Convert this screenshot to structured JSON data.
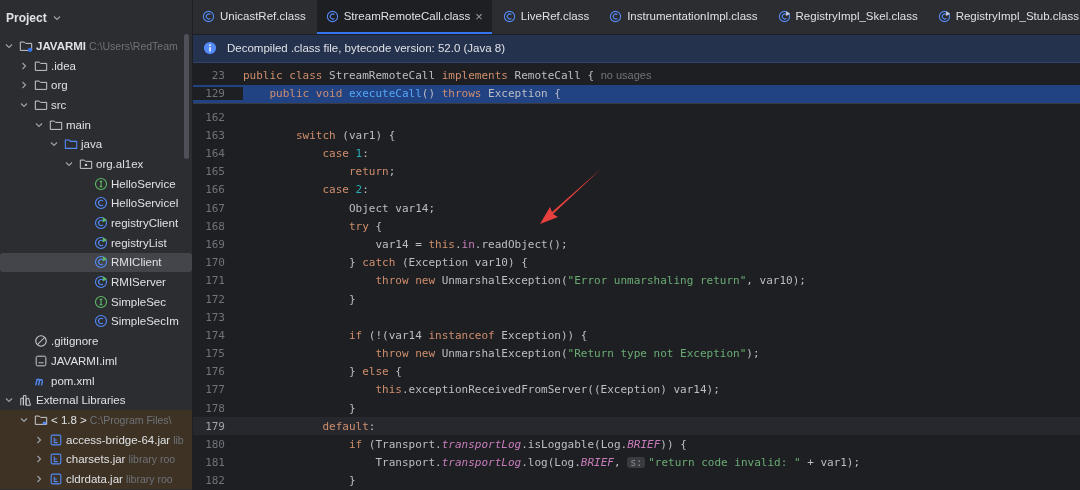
{
  "sidebar": {
    "title": "Project",
    "tree": [
      {
        "name": "JAVARMI",
        "kind": "project",
        "hint": "C:\\Users\\RedTeam",
        "expanded": true,
        "selected": false,
        "children": [
          {
            "name": ".idea",
            "kind": "folder",
            "expanded": false,
            "selected": false
          },
          {
            "name": "org",
            "kind": "folder",
            "expanded": false,
            "selected": false
          },
          {
            "name": "src",
            "kind": "folder",
            "expanded": true,
            "selected": false,
            "children": [
              {
                "name": "main",
                "kind": "folder",
                "expanded": true,
                "selected": false,
                "children": [
                  {
                    "name": "java",
                    "kind": "source-folder",
                    "expanded": true,
                    "selected": false,
                    "children": [
                      {
                        "name": "org.al1ex",
                        "kind": "package",
                        "expanded": true,
                        "selected": false,
                        "children": [
                          {
                            "name": "HelloService",
                            "kind": "interface",
                            "selected": false
                          },
                          {
                            "name": "HelloServiceI",
                            "kind": "class",
                            "selected": false
                          },
                          {
                            "name": "registryClient",
                            "kind": "runnable",
                            "selected": false
                          },
                          {
                            "name": "registryList",
                            "kind": "runnable",
                            "selected": false
                          },
                          {
                            "name": "RMIClient",
                            "kind": "runnable",
                            "selected": true
                          },
                          {
                            "name": "RMIServer",
                            "kind": "runnable",
                            "selected": false
                          },
                          {
                            "name": "SimpleSec",
                            "kind": "interface",
                            "selected": false
                          },
                          {
                            "name": "SimpleSecIm",
                            "kind": "class",
                            "selected": false
                          }
                        ]
                      }
                    ]
                  }
                ]
              }
            ]
          },
          {
            "name": ".gitignore",
            "kind": "ignore",
            "selected": false
          },
          {
            "name": "JAVARMI.iml",
            "kind": "module-file",
            "selected": false
          },
          {
            "name": "pom.xml",
            "kind": "maven",
            "selected": false
          }
        ]
      },
      {
        "name": "External Libraries",
        "kind": "libraries",
        "expanded": true,
        "selected": false,
        "children": [
          {
            "name": "< 1.8 >",
            "kind": "jdk",
            "hint": "C:\\Program Files\\",
            "expanded": true,
            "selected": false,
            "children": [
              {
                "name": "access-bridge-64.jar",
                "kind": "jar",
                "hint": "lib",
                "expanded": false,
                "selected": false
              },
              {
                "name": "charsets.jar",
                "kind": "jar",
                "hint": "library roo",
                "expanded": false,
                "selected": false
              },
              {
                "name": "cldrdata.jar",
                "kind": "jar",
                "hint": "library roo",
                "expanded": false,
                "selected": false
              }
            ]
          }
        ]
      }
    ]
  },
  "tabs": [
    {
      "label": "UnicastRef.class",
      "kind": "class",
      "selected": false
    },
    {
      "label": "StreamRemoteCall.class",
      "kind": "class",
      "selected": true,
      "close": "×"
    },
    {
      "label": "LiveRef.class",
      "kind": "class",
      "selected": false
    },
    {
      "label": "InstrumentationImpl.class",
      "kind": "class",
      "selected": false
    },
    {
      "label": "RegistryImpl_Skel.class",
      "kind": "runnable",
      "selected": false
    },
    {
      "label": "RegistryImpl_Stub.class",
      "kind": "runnable",
      "selected": false
    }
  ],
  "info_bar": {
    "text": "Decompiled .class file, bytecode version: 52.0 (Java 8)"
  },
  "sticky_lines": [
    {
      "number": "23",
      "selected": false,
      "tokens": [
        {
          "kind": "kw",
          "t": "public class "
        },
        {
          "kind": "plain",
          "t": "StreamRemoteCall "
        },
        {
          "kind": "kw",
          "t": "implements "
        },
        {
          "kind": "plain",
          "t": "RemoteCall { "
        },
        {
          "kind": "hint",
          "t": "no usages"
        }
      ],
      "children": [
        {
          "number": "129",
          "selected": true,
          "tokens": [
            {
              "kind": "kw",
              "t": "public void "
            },
            {
              "kind": "fn",
              "t": "executeCall"
            },
            {
              "kind": "plain",
              "t": "() "
            },
            {
              "kind": "kw",
              "t": "throws "
            },
            {
              "kind": "plain",
              "t": "Exception {"
            }
          ]
        }
      ]
    }
  ],
  "code": [
    {
      "number": "162",
      "current": false
    },
    {
      "number": "163",
      "current": false,
      "tokens": [
        {
          "kind": "kw",
          "t": "switch"
        },
        {
          "kind": "plain",
          "t": " (var1) {"
        }
      ],
      "children": [
        {
          "number": "164",
          "current": false,
          "tokens": [
            {
              "kind": "kw",
              "t": "case "
            },
            {
              "kind": "num",
              "t": "1"
            },
            {
              "kind": "plain",
              "t": ":"
            }
          ],
          "children": [
            {
              "number": "165",
              "current": false,
              "tokens": [
                {
                  "kind": "kw",
                  "t": "return"
                },
                {
                  "kind": "plain",
                  "t": ";"
                }
              ]
            }
          ]
        },
        {
          "number": "166",
          "current": false,
          "tokens": [
            {
              "kind": "kw",
              "t": "case "
            },
            {
              "kind": "num",
              "t": "2"
            },
            {
              "kind": "plain",
              "t": ":"
            }
          ],
          "children": [
            {
              "number": "167",
              "current": false,
              "tokens": [
                {
                  "kind": "plain",
                  "t": "Object var14;"
                }
              ]
            },
            {
              "number": "168",
              "current": false,
              "tokens": [
                {
                  "kind": "kw",
                  "t": "try"
                },
                {
                  "kind": "plain",
                  "t": " {"
                }
              ],
              "children": [
                {
                  "number": "169",
                  "current": false,
                  "tokens": [
                    {
                      "kind": "plain",
                      "t": "var14 = "
                    },
                    {
                      "kind": "kw",
                      "t": "this"
                    },
                    {
                      "kind": "plain",
                      "t": "."
                    },
                    {
                      "kind": "field",
                      "t": "in"
                    },
                    {
                      "kind": "plain",
                      "t": ".readObject();"
                    }
                  ]
                }
              ]
            },
            {
              "number": "170",
              "current": false,
              "tokens": [
                {
                  "kind": "plain",
                  "t": "} "
                },
                {
                  "kind": "kw",
                  "t": "catch"
                },
                {
                  "kind": "plain",
                  "t": " (Exception var10) {"
                }
              ],
              "children": [
                {
                  "number": "171",
                  "current": false,
                  "tokens": [
                    {
                      "kind": "kw",
                      "t": "throw new "
                    },
                    {
                      "kind": "plain",
                      "t": "UnmarshalException("
                    },
                    {
                      "kind": "str",
                      "t": "\"Error unmarshaling return\""
                    },
                    {
                      "kind": "plain",
                      "t": ", var10);"
                    }
                  ]
                }
              ]
            },
            {
              "number": "172",
              "current": false,
              "tokens": [
                {
                  "kind": "plain",
                  "t": "}"
                }
              ]
            },
            {
              "number": "173",
              "current": false
            },
            {
              "number": "174",
              "current": false,
              "tokens": [
                {
                  "kind": "kw",
                  "t": "if"
                },
                {
                  "kind": "plain",
                  "t": " (!(var14 "
                },
                {
                  "kind": "kw",
                  "t": "instanceof"
                },
                {
                  "kind": "plain",
                  "t": " Exception)) {"
                }
              ],
              "children": [
                {
                  "number": "175",
                  "current": false,
                  "tokens": [
                    {
                      "kind": "kw",
                      "t": "throw new "
                    },
                    {
                      "kind": "plain",
                      "t": "UnmarshalException("
                    },
                    {
                      "kind": "str",
                      "t": "\"Return type not Exception\""
                    },
                    {
                      "kind": "plain",
                      "t": ");"
                    }
                  ]
                }
              ]
            },
            {
              "number": "176",
              "current": false,
              "tokens": [
                {
                  "kind": "plain",
                  "t": "} "
                },
                {
                  "kind": "kw",
                  "t": "else"
                },
                {
                  "kind": "plain",
                  "t": " {"
                }
              ],
              "children": [
                {
                  "number": "177",
                  "current": false,
                  "tokens": [
                    {
                      "kind": "kw",
                      "t": "this"
                    },
                    {
                      "kind": "plain",
                      "t": ".exceptionReceivedFromServer((Exception) var14);"
                    }
                  ]
                }
              ]
            },
            {
              "number": "178",
              "current": false,
              "tokens": [
                {
                  "kind": "plain",
                  "t": "}"
                }
              ]
            }
          ]
        },
        {
          "number": "179",
          "current": true,
          "tokens": [
            {
              "kind": "kw",
              "t": "default"
            },
            {
              "kind": "plain",
              "t": ":"
            }
          ],
          "children": [
            {
              "number": "180",
              "current": false,
              "tokens": [
                {
                  "kind": "kw",
                  "t": "if"
                },
                {
                  "kind": "plain",
                  "t": " (Transport."
                },
                {
                  "kind": "static",
                  "t": "transportLog"
                },
                {
                  "kind": "plain",
                  "t": ".isLoggable(Log."
                },
                {
                  "kind": "static",
                  "t": "BRIEF"
                },
                {
                  "kind": "plain",
                  "t": ")) {"
                }
              ],
              "children": [
                {
                  "number": "181",
                  "current": false,
                  "tokens": [
                    {
                      "kind": "plain",
                      "t": "Transport."
                    },
                    {
                      "kind": "static",
                      "t": "transportLog"
                    },
                    {
                      "kind": "plain",
                      "t": ".log(Log."
                    },
                    {
                      "kind": "static",
                      "t": "BRIEF"
                    },
                    {
                      "kind": "plain",
                      "t": ", "
                    },
                    {
                      "kind": "inlay",
                      "t": "s:"
                    },
                    {
                      "kind": "str",
                      "t": "\"return code invalid: \""
                    },
                    {
                      "kind": "plain",
                      "t": " + var1);"
                    }
                  ]
                }
              ]
            },
            {
              "number": "182",
              "current": false,
              "tokens": [
                {
                  "kind": "plain",
                  "t": "}"
                }
              ]
            }
          ]
        }
      ]
    }
  ]
}
